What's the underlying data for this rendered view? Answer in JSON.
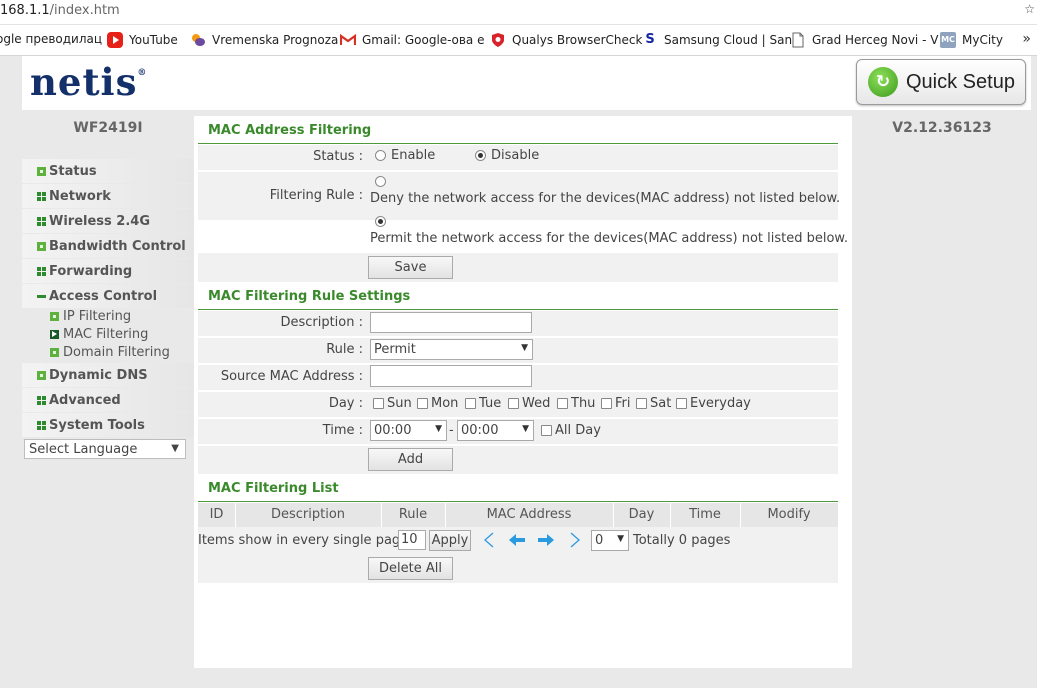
{
  "browser": {
    "url_host": "168.1.1",
    "url_path": "/index.htm",
    "bookmarks": [
      {
        "label": "ogle преводилац",
        "icon": "google-translate-icon"
      },
      {
        "label": "YouTube",
        "icon": "youtube-icon"
      },
      {
        "label": "Vremenska Prognoza",
        "icon": "weather-icon"
      },
      {
        "label": "Gmail: Google-ова е",
        "icon": "gmail-icon"
      },
      {
        "label": "Qualys BrowserCheck",
        "icon": "qualys-icon"
      },
      {
        "label": "Samsung Cloud | San",
        "icon": "samsung-icon"
      },
      {
        "label": "Grad Herceg Novi - V",
        "icon": "page-icon"
      },
      {
        "label": "MyCity",
        "icon": "mycity-icon"
      }
    ]
  },
  "header": {
    "logo": "netis",
    "logo_mark": "®",
    "quick_setup": "Quick Setup"
  },
  "sidebar": {
    "model": "WF2419I",
    "items": [
      {
        "label": "Status",
        "icon": "star"
      },
      {
        "label": "Network",
        "icon": "grid"
      },
      {
        "label": "Wireless 2.4G",
        "icon": "grid"
      },
      {
        "label": "Bandwidth Control",
        "icon": "star"
      },
      {
        "label": "Forwarding",
        "icon": "grid"
      },
      {
        "label": "Access Control",
        "icon": "minus"
      },
      {
        "label": "Dynamic DNS",
        "icon": "star"
      },
      {
        "label": "Advanced",
        "icon": "grid"
      },
      {
        "label": "System Tools",
        "icon": "grid"
      }
    ],
    "sub_items": [
      {
        "label": "IP Filtering",
        "active": false
      },
      {
        "label": "MAC Filtering",
        "active": true
      },
      {
        "label": "Domain Filtering",
        "active": false
      }
    ],
    "language": "Select Language"
  },
  "version": "V2.12.36123",
  "mac_filter": {
    "title": "MAC Address Filtering",
    "status_label": "Status :",
    "status_enable": "Enable",
    "status_disable": "Disable",
    "status_value": "Disable",
    "rule_label": "Filtering Rule :",
    "rule_deny": "Deny the network access for the devices(MAC address) not listed below.",
    "rule_permit": "Permit the network access for the devices(MAC address) not listed below.",
    "rule_value": "Permit",
    "save": "Save"
  },
  "rule_settings": {
    "title": "MAC Filtering Rule Settings",
    "description_label": "Description :",
    "description_value": "",
    "rule_label": "Rule :",
    "rule_value": "Permit",
    "mac_label": "Source MAC Address :",
    "mac_value": "",
    "day_label": "Day :",
    "days": [
      "Sun",
      "Mon",
      "Tue",
      "Wed",
      "Thu",
      "Fri",
      "Sat",
      "Everyday"
    ],
    "time_label": "Time :",
    "time_from": "00:00",
    "time_sep": "-",
    "time_to": "00:00",
    "all_day": "All Day",
    "add": "Add"
  },
  "list": {
    "title": "MAC Filtering List",
    "columns": [
      "ID",
      "Description",
      "Rule",
      "MAC Address",
      "Day",
      "Time",
      "Modify"
    ],
    "items_label": "Items show in every single page",
    "items_per_page": "10",
    "apply": "Apply",
    "page_value": "0",
    "totally": "Totally 0 pages",
    "delete_all": "Delete All"
  }
}
